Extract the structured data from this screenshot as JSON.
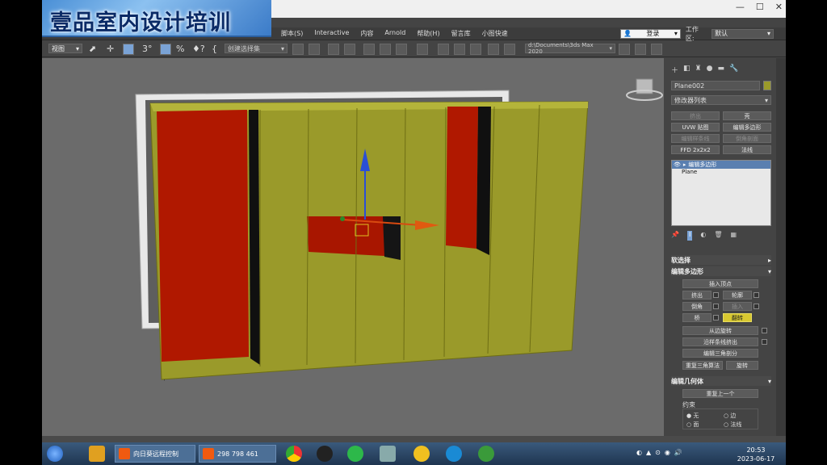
{
  "banner": {
    "text": "壹品室内设计培训"
  },
  "menubar": {
    "items": [
      "脚本(S)",
      "Interactive",
      "内容",
      "Arnold",
      "帮助(H)",
      "留言库",
      "小图快速"
    ],
    "signin": "登录",
    "workspace_label": "工作区:",
    "workspace_value": "默认"
  },
  "toolbar": {
    "view": "视图",
    "selection_set": "创建选择集",
    "path": "d:\\Documents\\3ds Max 2020"
  },
  "panel": {
    "object_name": "Plane002",
    "modifier_list": "修改器列表",
    "buttons": [
      "挤出",
      "壳",
      "UVW 贴图",
      "编辑多边形",
      "编辑样条线",
      "倒角剖面",
      "FFD 2x2x2",
      "法线"
    ],
    "stack": [
      "编辑多边形",
      "Plane"
    ],
    "rollout_soft": "软选择",
    "rollout_edit_poly": "编辑多边形",
    "insert_vertex": "插入顶点",
    "extrude": "挤出",
    "outline": "轮廓",
    "bevel": "倒角",
    "inset": "插入",
    "bridge": "桥",
    "flip": "翻转",
    "hinge": "从边旋转",
    "extrude_spline": "沿样条线挤出",
    "edit_tri": "编辑三角剖分",
    "retriangulate": "重复三角算法",
    "turn": "旋转",
    "rollout_edit_geom": "编辑几何体",
    "repeat_last": "重复上一个",
    "constraints": "约束",
    "c_none": "无",
    "c_edge": "边",
    "c_face": "面",
    "c_normal": "法线"
  },
  "taskbar": {
    "app1": "向日葵远程控制",
    "app2": "298 798 461",
    "time": "20:53",
    "date": "2023-06-17"
  },
  "colors": {
    "wardrobe": "#9a9a2a",
    "red_panel": "#b01800",
    "accent": "#7aa3d6"
  }
}
